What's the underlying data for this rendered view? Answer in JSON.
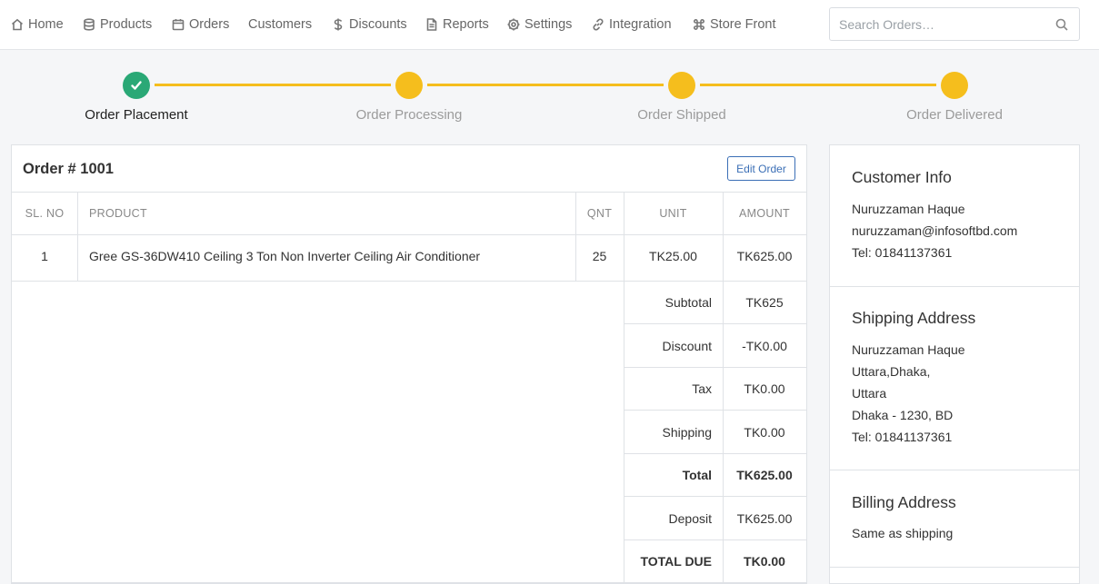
{
  "nav": {
    "items": [
      {
        "label": "Home",
        "icon": "home-icon"
      },
      {
        "label": "Products",
        "icon": "database-icon"
      },
      {
        "label": "Orders",
        "icon": "calendar-icon"
      },
      {
        "label": "Customers",
        "icon": ""
      },
      {
        "label": "Discounts",
        "icon": "dollar-icon"
      },
      {
        "label": "Reports",
        "icon": "document-icon"
      },
      {
        "label": "Settings",
        "icon": "gear-icon"
      },
      {
        "label": "Integration",
        "icon": "link-icon"
      },
      {
        "label": "Store Front",
        "icon": "command-icon"
      }
    ],
    "search_placeholder": "Search Orders…"
  },
  "tracker": {
    "steps": [
      {
        "label": "Order Placement",
        "status": "done"
      },
      {
        "label": "Order Processing",
        "status": "pending"
      },
      {
        "label": "Order Shipped",
        "status": "pending"
      },
      {
        "label": "Order Delivered",
        "status": "pending"
      }
    ],
    "colors": {
      "done": "#2aa876",
      "pending": "#f5be1d"
    }
  },
  "order": {
    "title": "Order # 1001",
    "edit_label": "Edit Order",
    "columns": [
      "SL. NO",
      "PRODUCT",
      "QNT",
      "UNIT",
      "AMOUNT"
    ],
    "rows": [
      {
        "sl": "1",
        "product": "Gree GS-36DW410 Ceiling 3 Ton Non Inverter Ceiling Air Conditioner",
        "qnt": "25",
        "unit": "TK25.00",
        "amount": "TK625.00"
      }
    ],
    "summary": [
      {
        "label": "Subtotal",
        "value": "TK625"
      },
      {
        "label": "Discount",
        "value": "-TK0.00"
      },
      {
        "label": "Tax",
        "value": "TK0.00"
      },
      {
        "label": "Shipping",
        "value": "TK0.00"
      },
      {
        "label": "Total",
        "value": "TK625.00"
      },
      {
        "label": "Deposit",
        "value": "TK625.00"
      },
      {
        "label": "TOTAL DUE",
        "value": "TK0.00"
      }
    ]
  },
  "customer": {
    "title": "Customer Info",
    "name": "Nuruzzaman Haque",
    "email": "nuruzzaman@infosoftbd.com",
    "tel": "Tel: 01841137361"
  },
  "shipping": {
    "title": "Shipping Address",
    "lines": [
      "Nuruzzaman Haque",
      "Uttara,Dhaka,",
      "Uttara",
      "Dhaka - 1230, BD",
      "Tel: 01841137361"
    ]
  },
  "billing": {
    "title": "Billing Address",
    "text": "Same as shipping"
  }
}
